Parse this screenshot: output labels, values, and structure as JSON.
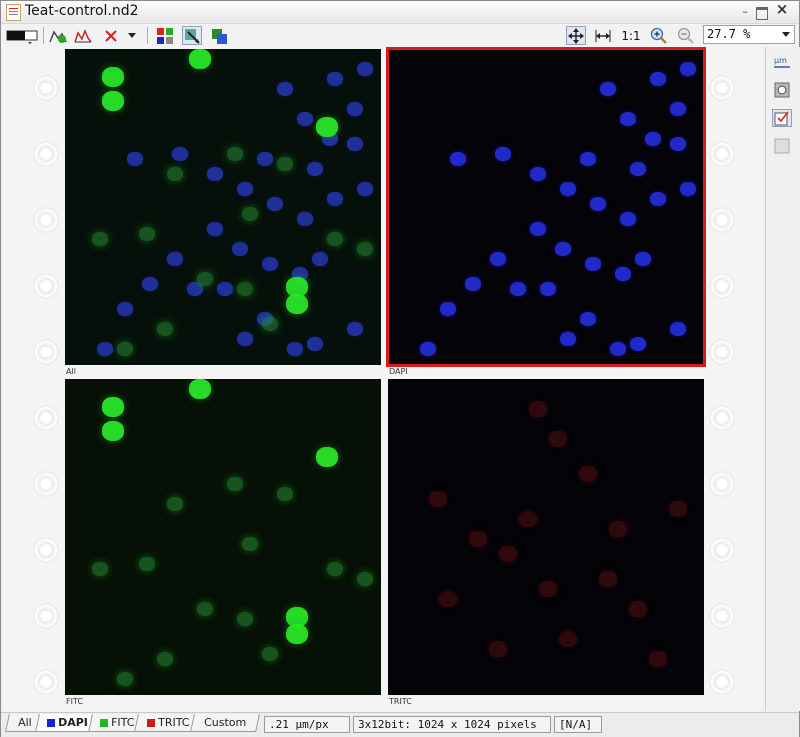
{
  "window": {
    "title": "Teat-control.nd2"
  },
  "toolbar": {
    "one_to_one_label": "1:1",
    "zoom_value": "27.7 %"
  },
  "panes": [
    {
      "label": "All",
      "selected": false
    },
    {
      "label": "DAPI",
      "selected": true
    },
    {
      "label": "FITC",
      "selected": false
    },
    {
      "label": "TRITC",
      "selected": false
    }
  ],
  "channel_tabs": [
    {
      "label": "All",
      "swatch": null,
      "active": false
    },
    {
      "label": "DAPI",
      "swatch": "#1428c8",
      "active": true
    },
    {
      "label": "FITC",
      "swatch": "#1fb81f",
      "active": false
    },
    {
      "label": "TRITC",
      "swatch": "#d01818",
      "active": false
    },
    {
      "label": "Custom",
      "swatch": null,
      "active": false
    }
  ],
  "status": {
    "resolution": ".21 µm/px",
    "image_info": "3x12bit: 1024 x 1024 pixels",
    "extra": "[N/A]"
  },
  "colors": {
    "selection": "#d81c1c",
    "dapi": "#2430e6",
    "fitc": "#27e027",
    "tritc": "#7a1414"
  }
}
